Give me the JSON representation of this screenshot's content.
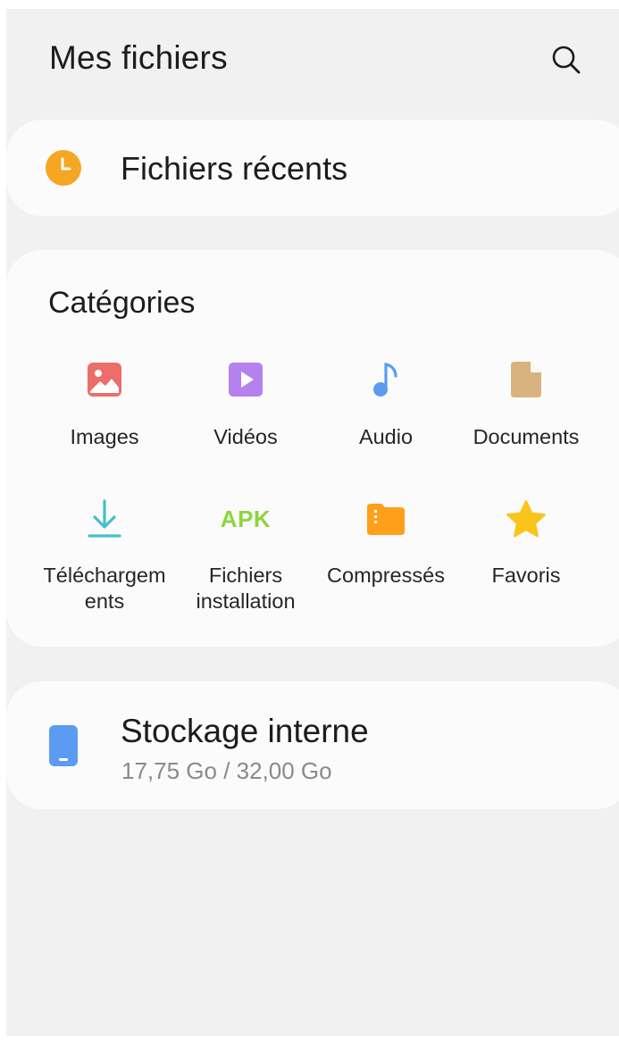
{
  "header": {
    "title": "Mes fichiers",
    "search_icon": "search-icon"
  },
  "recent": {
    "label": "Fichiers récents",
    "icon": "clock-icon",
    "color": "#f5a623"
  },
  "categories": {
    "title": "Catégories",
    "items": [
      {
        "label": "Images",
        "icon": "image-icon",
        "color": "#ec6d69"
      },
      {
        "label": "Vidéos",
        "icon": "video-icon",
        "color": "#b481ee"
      },
      {
        "label": "Audio",
        "icon": "music-note-icon",
        "color": "#5b9cf2"
      },
      {
        "label": "Documents",
        "icon": "document-icon",
        "color": "#d8b27f"
      },
      {
        "label": "Téléchargem\nents",
        "icon": "download-icon",
        "color": "#45c0c9"
      },
      {
        "label": "Fichiers\ninstallation",
        "icon": "apk-icon",
        "text": "APK",
        "color": "#8fd43c"
      },
      {
        "label": "Compressés",
        "icon": "zip-folder-icon",
        "color": "#ff9f1a"
      },
      {
        "label": "Favoris",
        "icon": "star-icon",
        "color": "#fbc41c"
      }
    ]
  },
  "storage": {
    "title": "Stockage interne",
    "usage": "17,75 Go / 32,00 Go",
    "icon": "phone-icon",
    "color": "#5b9cf2"
  }
}
